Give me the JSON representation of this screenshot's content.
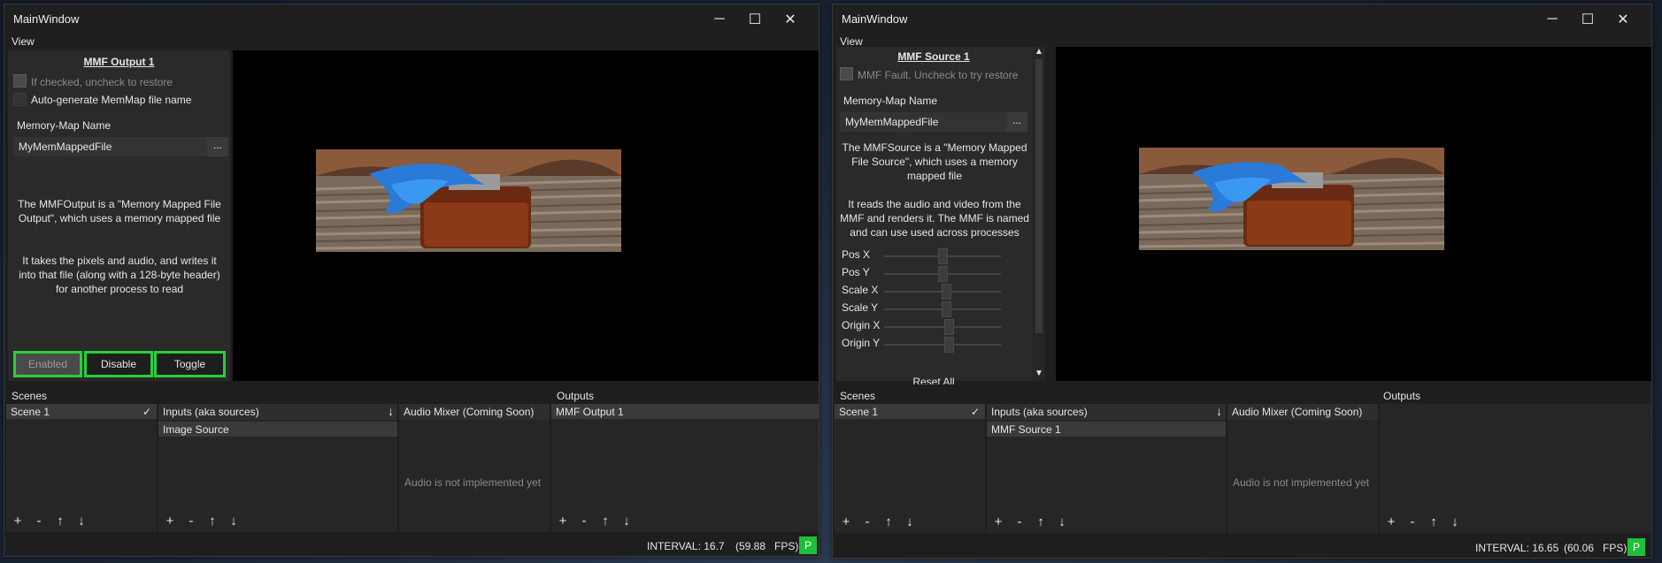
{
  "left": {
    "window_title": "MainWindow",
    "menu_view": "View",
    "panel_title": "MMF Output 1",
    "restore_check_label": "If checked, uncheck to restore",
    "autogen_label": "Auto-generate MemMap file name",
    "memmap_label": "Memory-Map Name",
    "memmap_value": "MyMemMappedFile",
    "browse_label": "...",
    "desc1": "The MMFOutput is a \"Memory Mapped File Output\", which uses a memory mapped file",
    "desc2": "It takes the pixels and audio, and writes it into that file (along with a 128-byte header) for another process to read",
    "btn_enabled": "Enabled",
    "btn_disable": "Disable",
    "btn_toggle": "Toggle",
    "scenes_title": "Scenes",
    "scene_1": "Scene 1",
    "inputs_header": "Inputs (aka sources)",
    "input_1": "Image Source",
    "audio_header": "Audio Mixer (Coming Soon)",
    "audio_msg": "Audio is not implemented yet",
    "outputs_title": "Outputs",
    "output_1": "MMF Output 1",
    "interval": "INTERVAL: 16.7",
    "fps": "(59.88",
    "fps_unit": "FPS)",
    "badge": "P"
  },
  "right": {
    "window_title": "MainWindow",
    "menu_view": "View",
    "panel_title": "MMF Source 1",
    "fault_label": "MMF Fault. Uncheck to try restore",
    "memmap_label": "Memory-Map Name",
    "memmap_value": "MyMemMappedFile",
    "browse_label": "...",
    "desc1": "The MMFSource is a \"Memory Mapped File Source\", which uses a memory mapped file",
    "desc2": "It reads the audio and video from the MMF and renders it. The MMF is named and can use used across processes",
    "sliders": [
      {
        "label": "Pos X",
        "value": 0.5
      },
      {
        "label": "Pos Y",
        "value": 0.5
      },
      {
        "label": "Scale X",
        "value": 0.53
      },
      {
        "label": "Scale Y",
        "value": 0.53
      },
      {
        "label": "Origin X",
        "value": 0.55
      },
      {
        "label": "Origin Y",
        "value": 0.55
      }
    ],
    "reset_all": "Reset All",
    "scenes_title": "Scenes",
    "scene_1": "Scene 1",
    "inputs_header": "Inputs (aka sources)",
    "input_1": "MMF Source 1",
    "audio_header": "Audio Mixer (Coming Soon)",
    "audio_msg": "Audio is not implemented yet",
    "outputs_title": "Outputs",
    "interval": "INTERVAL: 16.65",
    "fps": "(60.06",
    "fps_unit": "FPS)",
    "badge": "P"
  },
  "toolbar_glyphs": {
    "add": "+",
    "remove": "-",
    "up": "↑",
    "down": "↓"
  },
  "colors": {
    "accent_green": "#25d13a",
    "badge_green": "#1fbf3a"
  }
}
